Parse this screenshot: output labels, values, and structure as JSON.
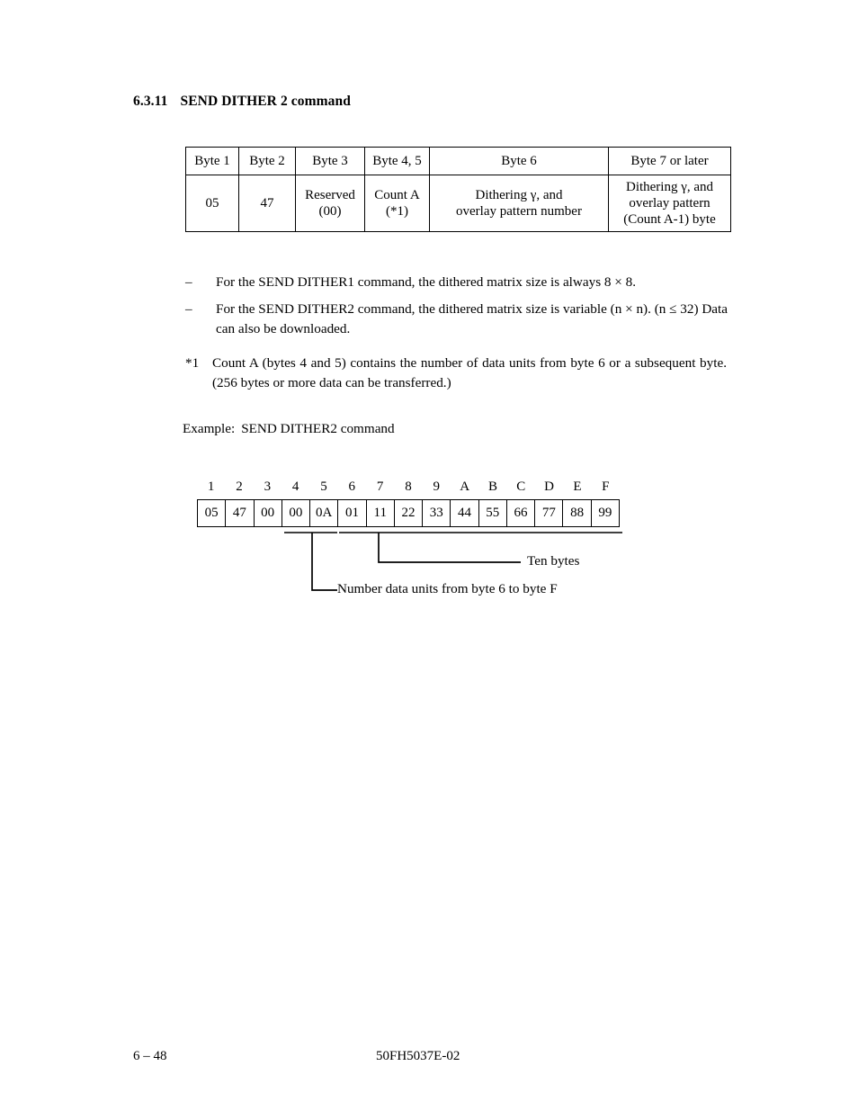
{
  "heading": {
    "number": "6.3.11",
    "title": "SEND DITHER 2 command"
  },
  "command_table": {
    "headers": [
      "Byte 1",
      "Byte 2",
      "Byte 3",
      "Byte 4, 5",
      "Byte 6",
      "Byte 7 or later"
    ],
    "row": [
      "05",
      "47",
      "Reserved\n(00)",
      "Count A\n(*1)",
      "Dithering γ, and\noverlay pattern number",
      "Dithering γ, and\noverlay pattern\n(Count A-1) byte"
    ],
    "cells": {
      "byte1": "05",
      "byte2": "47",
      "byte3_line1": "Reserved",
      "byte3_line2": "(00)",
      "byte45_line1": "Count A",
      "byte45_line2": "(*1)",
      "byte6_line1": "Dithering γ, and",
      "byte6_line2": "overlay pattern number",
      "byte7_line1": "Dithering γ, and",
      "byte7_line2": "overlay pattern",
      "byte7_line3": "(Count A-1) byte"
    }
  },
  "notes": [
    {
      "marker": "–",
      "text": "For the SEND DITHER1 command, the dithered matrix size is always 8 × 8."
    },
    {
      "marker": "–",
      "text": "For the SEND DITHER2 command, the dithered matrix size is variable (n × n).  (n ≤ 32)  Data can also be downloaded."
    },
    {
      "marker": "*1",
      "text": "Count A (bytes 4 and 5) contains the number of data units from byte 6 or a subsequent byte.  (256 bytes or more data can be transferred.)"
    }
  ],
  "example": {
    "label": "Example:",
    "title": "SEND DITHER2 command"
  },
  "byte_diagram": {
    "indices": [
      "1",
      "2",
      "3",
      "4",
      "5",
      "6",
      "7",
      "8",
      "9",
      "A",
      "B",
      "C",
      "D",
      "E",
      "F"
    ],
    "values": [
      "05",
      "47",
      "00",
      "00",
      "0A",
      "01",
      "11",
      "22",
      "33",
      "44",
      "55",
      "66",
      "77",
      "88",
      "99"
    ],
    "annotations": {
      "ten_bytes": "Ten bytes",
      "count_a": "Number data units from byte 6 to byte F"
    }
  },
  "footer": {
    "page_number": "6 – 48",
    "document_number": "50FH5037E-02"
  },
  "colors": {
    "text": "#000000",
    "background": "#ffffff",
    "rule": "#000000"
  }
}
